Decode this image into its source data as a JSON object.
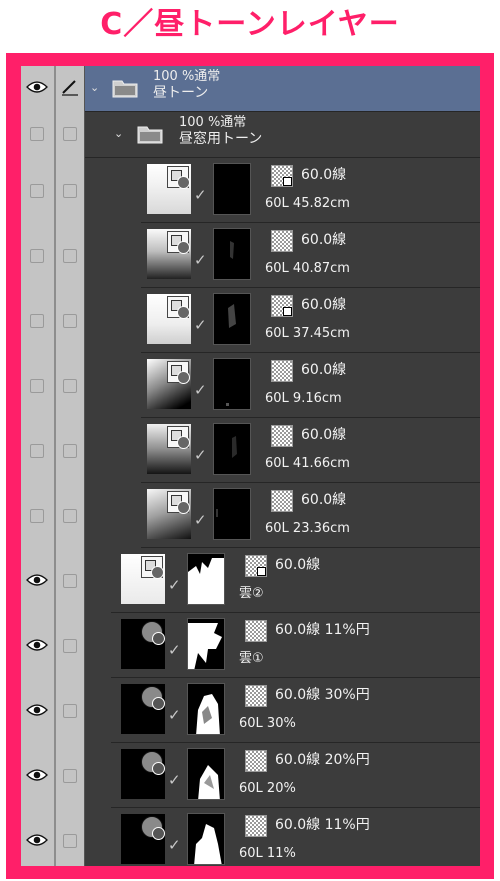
{
  "heading": "C／昼トーンレイヤー",
  "folders": [
    {
      "mode": "100 %通常",
      "name": "昼トーン",
      "selected": true
    },
    {
      "mode": "100 %通常",
      "name": "昼窓用トーン",
      "selected": false
    }
  ],
  "layers": [
    {
      "tone": "60.0線",
      "name": "60L 45.82cm"
    },
    {
      "tone": "60.0線",
      "name": "60L 40.87cm"
    },
    {
      "tone": "60.0線",
      "name": "60L 37.45cm"
    },
    {
      "tone": "60.0線",
      "name": "60L 9.16cm"
    },
    {
      "tone": "60.0線",
      "name": "60L 41.66cm"
    },
    {
      "tone": "60.0線",
      "name": "60L 23.36cm"
    },
    {
      "tone": "60.0線",
      "name": "雲②"
    },
    {
      "tone": "60.0線 11%円",
      "name": "雲①"
    },
    {
      "tone": "60.0線 30%円",
      "name": "60L 30%"
    },
    {
      "tone": "60.0線 20%円",
      "name": "60L 20%"
    },
    {
      "tone": "60.0線 11%円",
      "name": "60L 11%"
    }
  ],
  "colors": {
    "accent": "#ff1f69",
    "panel": "#3c3c3c",
    "selected": "#5b6f93",
    "column": "#c4c4c4"
  },
  "icons": [
    "eye-icon",
    "pen-icon",
    "folder-icon",
    "chevron-down-icon",
    "tone-icon",
    "check-icon"
  ]
}
